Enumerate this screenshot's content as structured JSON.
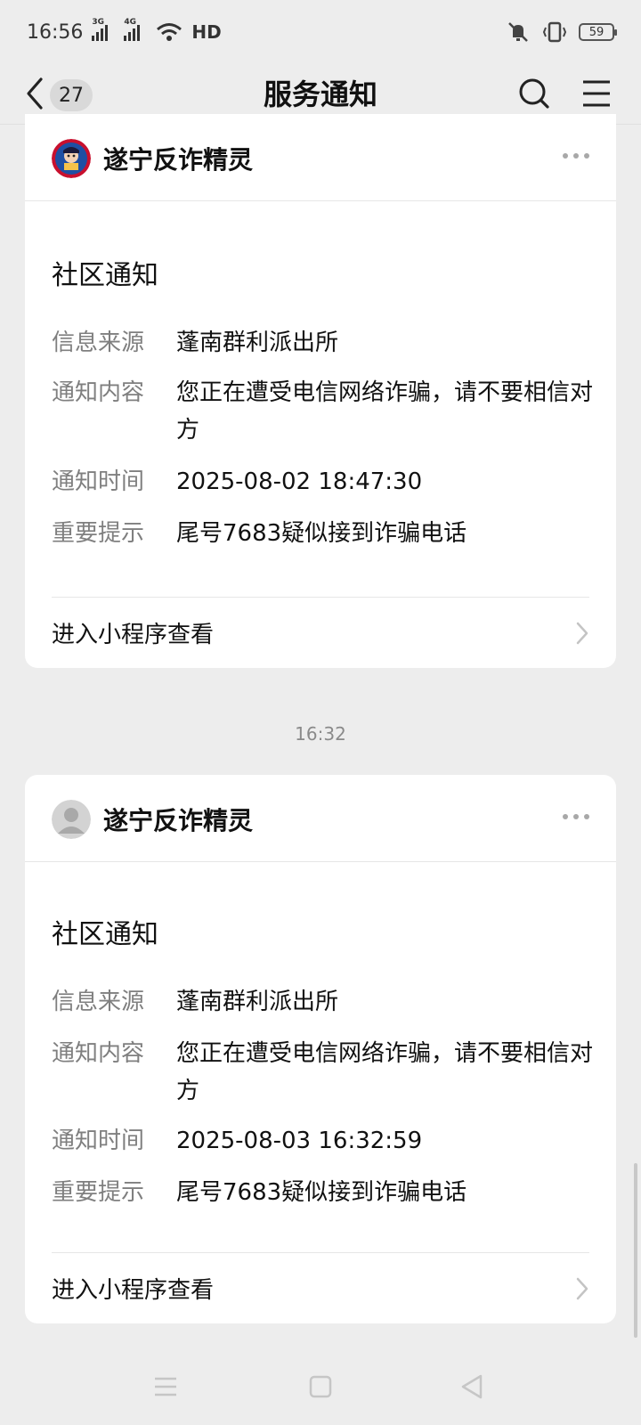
{
  "status_bar": {
    "time": "16:56",
    "network_1": "3G",
    "network_2": "4G",
    "hd": "HD",
    "battery": "59"
  },
  "nav": {
    "unread_count": "27",
    "title": "服务通知"
  },
  "messages": [
    {
      "sender": "遂宁反诈精灵",
      "title": "社区通知",
      "rows": [
        {
          "label": "信息来源",
          "value": "蓬南群利派出所"
        },
        {
          "label": "通知内容",
          "value": "您正在遭受电信网络诈骗，请不要相信对方"
        },
        {
          "label": "通知时间",
          "value": "2025-08-02 18:47:30"
        },
        {
          "label": "重要提示",
          "value": "尾号7683疑似接到诈骗电话"
        }
      ],
      "footer": "进入小程序查看"
    },
    {
      "sender": "遂宁反诈精灵",
      "title": "社区通知",
      "rows": [
        {
          "label": "信息来源",
          "value": "蓬南群利派出所"
        },
        {
          "label": "通知内容",
          "value": "您正在遭受电信网络诈骗，请不要相信对方"
        },
        {
          "label": "通知时间",
          "value": "2025-08-03 16:32:59"
        },
        {
          "label": "重要提示",
          "value": "尾号7683疑似接到诈骗电话"
        }
      ],
      "footer": "进入小程序查看"
    }
  ],
  "timestamp_divider": "16:32",
  "icons": {
    "back": "chevron-left-icon",
    "search": "search-icon",
    "menu": "hamburger-menu-icon",
    "more": "more-dots-icon",
    "footer_arrow": "chevron-right-icon"
  }
}
